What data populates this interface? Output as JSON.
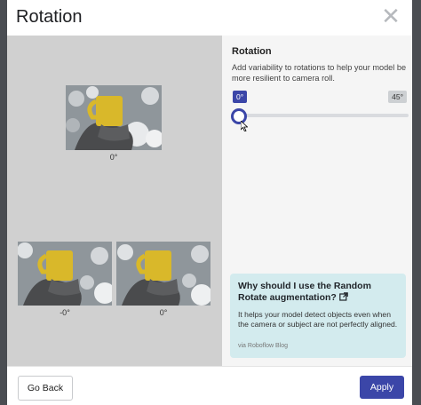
{
  "modal": {
    "title": "Rotation",
    "close_icon": "close-icon"
  },
  "preview": {
    "images": [
      {
        "caption": "0°"
      },
      {
        "caption": "-0°"
      },
      {
        "caption": "0°"
      }
    ]
  },
  "setting": {
    "title": "Rotation",
    "description": "Add variability to rotations to help your model be more resilient to camera roll.",
    "current_value": "0°",
    "max_value": "45°",
    "slider_value": 0
  },
  "info_card": {
    "title": "Why should I use the Random Rotate augmentation?",
    "title_icon": "external-link-icon",
    "body": "It helps your model detect objects even when the camera or subject are not perfectly aligned.",
    "source": "via Roboflow Blog"
  },
  "footer": {
    "back_label": "Go Back",
    "apply_label": "Apply"
  },
  "colors": {
    "accent": "#3b46a8",
    "info_card_bg": "#d3ebee"
  }
}
